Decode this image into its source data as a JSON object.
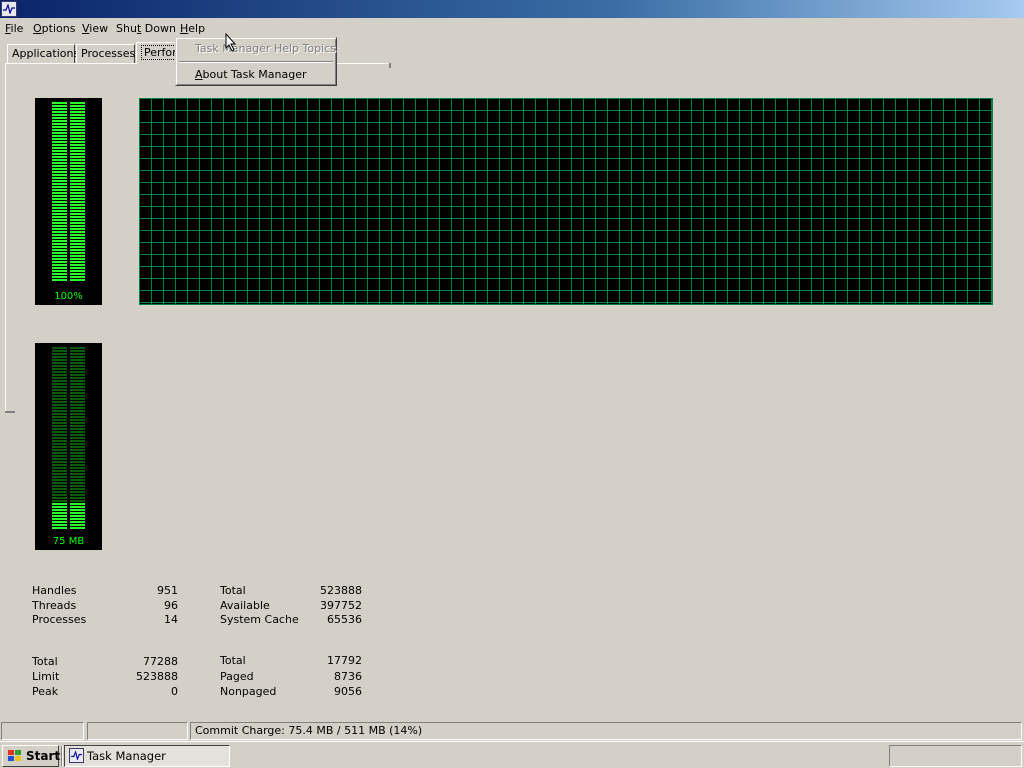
{
  "menu": {
    "items": [
      {
        "pre": "",
        "u": "F",
        "post": "ile"
      },
      {
        "pre": "",
        "u": "O",
        "post": "ptions"
      },
      {
        "pre": "",
        "u": "V",
        "post": "iew"
      },
      {
        "pre": "Shu",
        "u": "t",
        "post": " Down"
      },
      {
        "pre": "",
        "u": "H",
        "post": "elp"
      }
    ]
  },
  "help_menu": {
    "topics_label": "Task Manager Help Topics",
    "about": {
      "pre": "",
      "u": "A",
      "post": "bout Task Manager"
    }
  },
  "tabs": {
    "applications": "Applications",
    "processes": "Processes",
    "performance": "Perforr"
  },
  "cpu_meter": {
    "label": "100%",
    "level_percent": 100
  },
  "memory_meter": {
    "label": "75 MB",
    "level_percent": 14
  },
  "stats": {
    "totals": [
      {
        "label": "Handles",
        "value": "951"
      },
      {
        "label": "Threads",
        "value": "96"
      },
      {
        "label": "Processes",
        "value": "14"
      }
    ],
    "physical": [
      {
        "label": "Total",
        "value": "523888"
      },
      {
        "label": "Available",
        "value": "397752"
      },
      {
        "label": "System Cache",
        "value": "65536"
      }
    ],
    "commit": [
      {
        "label": "Total",
        "value": "77288"
      },
      {
        "label": "Limit",
        "value": "523888"
      },
      {
        "label": "Peak",
        "value": "0"
      }
    ],
    "kernel": [
      {
        "label": "Total",
        "value": "17792"
      },
      {
        "label": "Paged",
        "value": "8736"
      },
      {
        "label": "Nonpaged",
        "value": "9056"
      }
    ]
  },
  "statusbar": {
    "pane1": "",
    "pane2": "",
    "commit_charge": "Commit Charge: 75.4 MB / 511 MB (14%)"
  },
  "taskbar": {
    "start_label": "Start",
    "task_label": "Task Manager"
  },
  "colors": {
    "meter_on": "#2bff2b",
    "meter_off": "#0a5a0a",
    "grid": "#008040"
  }
}
